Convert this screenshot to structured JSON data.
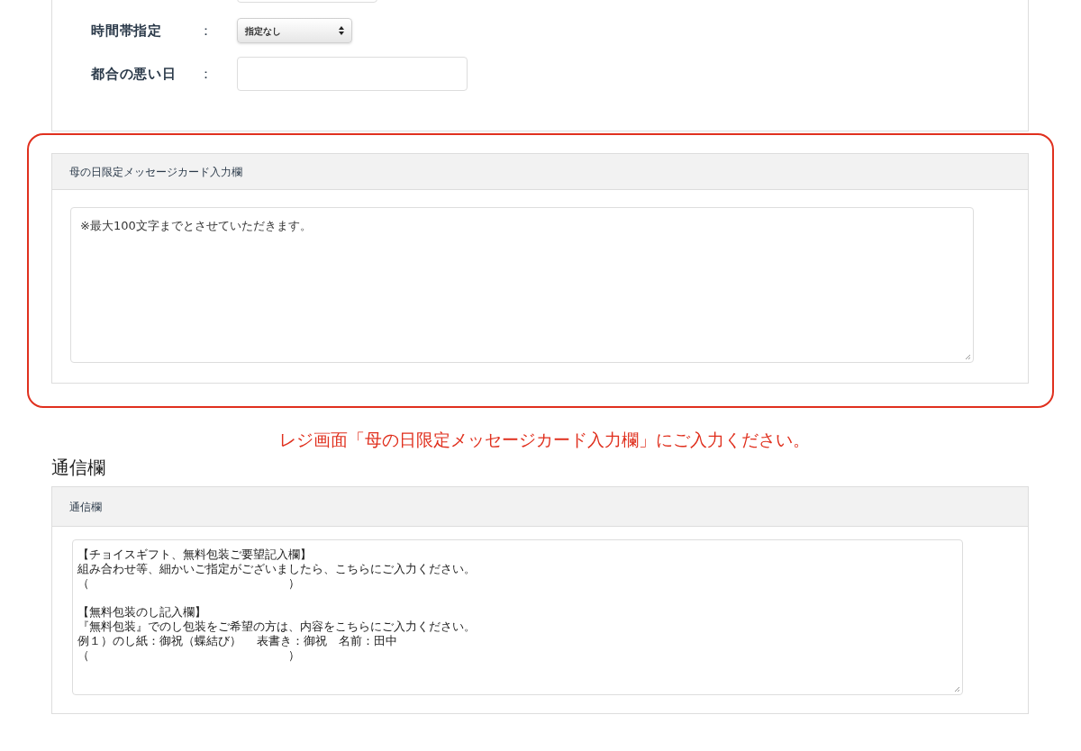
{
  "delivery_form": {
    "rows": [
      {
        "kind": "select",
        "label": "時間帯指定",
        "colon": "：",
        "value": "指定なし"
      },
      {
        "kind": "input",
        "label": "都合の悪い日",
        "colon": "："
      }
    ]
  },
  "message_card": {
    "header": "母の日限定メッセージカード入力欄",
    "placeholder": "※最大100文字までとさせていただきます。",
    "highlighted": true
  },
  "note": "レジ画面「母の日限定メッセージカード入力欄」にご入力ください。",
  "comments": {
    "heading": "通信欄",
    "header": "通信欄",
    "paragraphs": [
      [
        "【チョイスギフト、無料包装ご要望記入欄】",
        "組み合わせ等、細かいご指定がございましたら、こちらにご入力ください。",
        "（　　　　　　　　　　　　　　　　　）"
      ],
      [
        "【無料包装のし記入欄】",
        "『無料包装』でのし包装をご希望の方は、内容をこちらにご入力ください。",
        "例１）のし紙：御祝（蝶結び）　 表書き：御祝　名前：田中",
        "（　　　　　　　　　　　　　　　　　）"
      ]
    ]
  }
}
